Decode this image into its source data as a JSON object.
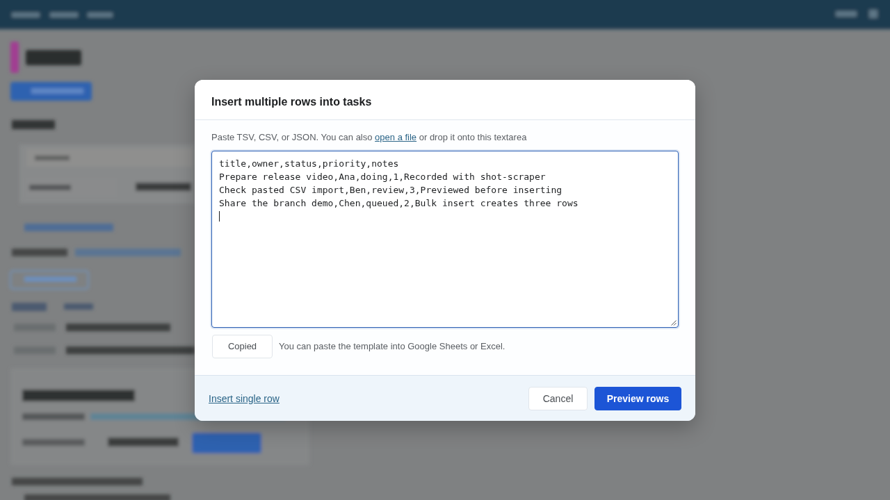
{
  "dialog": {
    "title": "Insert multiple rows into tasks",
    "intro": {
      "before": "Paste TSV, CSV, or JSON. You can also ",
      "link": "open a file",
      "after": " or drop it onto this textarea"
    },
    "textarea": {
      "lines": [
        "title,owner,status,priority,notes",
        "Prepare release video,Ana,doing,1,Recorded with shot-scraper",
        "Check pasted CSV import,Ben,review,3,Previewed before inserting",
        "Share the branch demo,Chen,queued,2,Bulk insert creates three rows"
      ],
      "focused": true
    },
    "copy_button": "Copied",
    "copy_note": "You can paste the template into Google Sheets or Excel.",
    "footer": {
      "link": "Insert single row",
      "buttons": [
        {
          "label": "Cancel",
          "kind": "secondary"
        },
        {
          "label": "Preview rows",
          "kind": "primary"
        }
      ]
    }
  }
}
